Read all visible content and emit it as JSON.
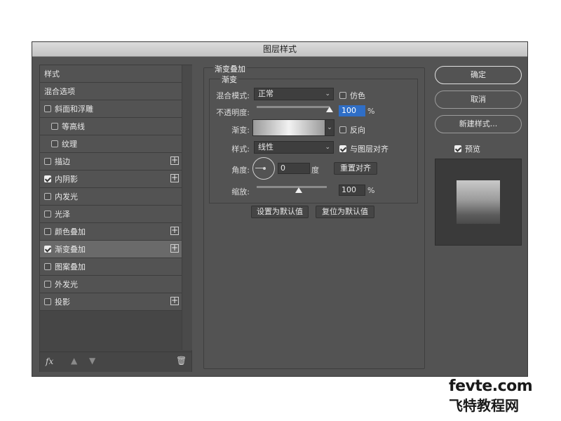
{
  "window": {
    "title": "图层样式"
  },
  "left_list": {
    "items": [
      {
        "label": "样式",
        "type": "header"
      },
      {
        "label": "混合选项",
        "type": "header"
      },
      {
        "label": "斜面和浮雕",
        "checked": false,
        "plus": false,
        "indent": false
      },
      {
        "label": "等高线",
        "checked": false,
        "plus": false,
        "indent": true
      },
      {
        "label": "纹理",
        "checked": false,
        "plus": false,
        "indent": true
      },
      {
        "label": "描边",
        "checked": false,
        "plus": true,
        "indent": false
      },
      {
        "label": "内阴影",
        "checked": true,
        "plus": true,
        "indent": false
      },
      {
        "label": "内发光",
        "checked": false,
        "plus": false,
        "indent": false
      },
      {
        "label": "光泽",
        "checked": false,
        "plus": false,
        "indent": false
      },
      {
        "label": "颜色叠加",
        "checked": false,
        "plus": true,
        "indent": false
      },
      {
        "label": "渐变叠加",
        "checked": true,
        "plus": true,
        "indent": false,
        "selected": true
      },
      {
        "label": "图案叠加",
        "checked": false,
        "plus": false,
        "indent": false
      },
      {
        "label": "外发光",
        "checked": false,
        "plus": false,
        "indent": false
      },
      {
        "label": "投影",
        "checked": false,
        "plus": true,
        "indent": false
      }
    ],
    "fx_label": "fx"
  },
  "panel": {
    "group_title": "渐变叠加",
    "sub_title": "渐变",
    "blend_mode_label": "混合模式:",
    "blend_mode_value": "正常",
    "dither_label": "仿色",
    "dither_checked": false,
    "opacity_label": "不透明度:",
    "opacity_value": "100",
    "opacity_fraction": 1.0,
    "percent": "%",
    "gradient_label": "渐变:",
    "reverse_label": "反向",
    "reverse_checked": false,
    "style_label": "样式:",
    "style_value": "线性",
    "align_label": "与图层对齐",
    "align_checked": true,
    "angle_label": "角度:",
    "angle_value": "0",
    "degree_unit": "度",
    "reset_align_label": "重置对齐",
    "scale_label": "缩放:",
    "scale_value": "100",
    "scale_fraction": 0.6,
    "set_default_label": "设置为默认值",
    "reset_default_label": "复位为默认值"
  },
  "right": {
    "ok_label": "确定",
    "cancel_label": "取消",
    "new_style_label": "新建样式...",
    "preview_label": "预览",
    "preview_checked": true
  },
  "watermark": {
    "line1": "fevte.com",
    "line2": "飞特教程网"
  },
  "colors": {
    "dialog_bg": "#535353",
    "selected_row": "#6a6a6a",
    "focus_blue": "#2f6ec6"
  }
}
